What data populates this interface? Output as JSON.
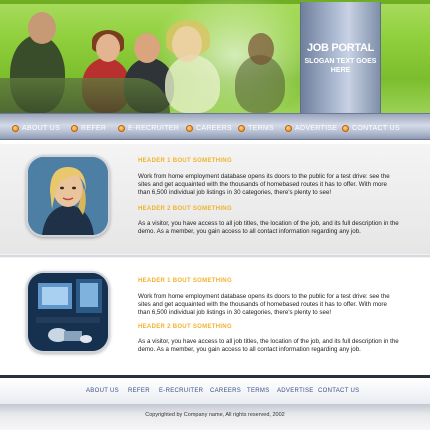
{
  "header": {
    "portal_title": "JOB PORTAL",
    "slogan": "SLOGAN TEXT GOES HERE"
  },
  "nav": {
    "items": [
      "ABOUT US",
      "REFER",
      "E-RECRUITER",
      "CAREERS",
      "TERMS",
      "ADVERTISE",
      "CONTACT US"
    ]
  },
  "sections": [
    {
      "heading1": "HEADER 1 BOUT SOMETHING",
      "para1": "Work from home employment database opens its doors to the public for a test drive: see the sites and get  acquainted with the thousands of homebased routes it  has to offer. With more than 6,500 individual job listings in 30 categories, there's plenty to see!",
      "heading2": "HEADER 2 BOUT SOMETHING",
      "para2": "As a visitor, you have access to all job titles, the location of the job, and its full description in the demo. As a member, you gain access to all contact  information regarding any job."
    },
    {
      "heading1": "HEADER 1 BOUT SOMETHING",
      "para1": "Work from home employment database opens its doors to the public for a test drive: see the sites and get  acquainted with the thousands of homebased routes it  has to offer. With more than 6,500 individual job listings in 30 categories, there's plenty to see!",
      "heading2": "HEADER 2 BOUT SOMETHING",
      "para2": "As a visitor, you have access to all job titles, the location of the job, and its full description in the demo. As a member, you gain access to all contact  information regarding any job."
    }
  ],
  "footer": {
    "nav": [
      "ABOUT US",
      "REFER",
      "E-RECRUITER",
      "CAREERS",
      "TERMS",
      "ADVERTISE",
      "CONTACT US"
    ],
    "copyright": "Copyrighted by Company name, All rights reserved, 2002"
  },
  "colors": {
    "accent_green": "#8fcf3c",
    "heading_orange": "#f2b12f",
    "nav_blue_gray": "#b9c2d4",
    "footer_link": "#3b4f8a"
  },
  "icons": {
    "nav_bullet": "orange-bullet-icon",
    "thumb1": "woman-portrait-photo",
    "thumb2": "computer-workstation-photo"
  }
}
